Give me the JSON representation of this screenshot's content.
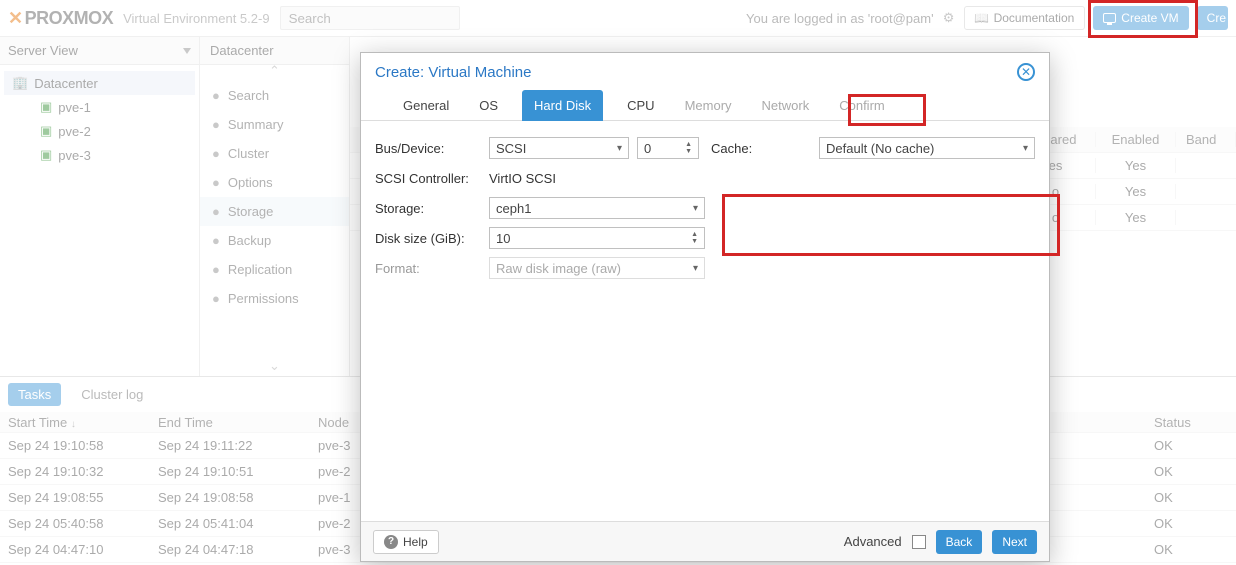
{
  "header": {
    "brand": "PROXMOX",
    "subtitle": "Virtual Environment 5.2-9",
    "search_placeholder": "Search",
    "login_msg": "You are logged in as 'root@pam'",
    "doc_label": "Documentation",
    "create_vm_label": "Create VM",
    "create_ct_label": "Cre"
  },
  "sidebar": {
    "mode": "Server View",
    "root": "Datacenter",
    "nodes": [
      "pve-1",
      "pve-2",
      "pve-3"
    ]
  },
  "mid": {
    "title": "Datacenter",
    "items": [
      {
        "label": "Search",
        "icon": "search-icon"
      },
      {
        "label": "Summary",
        "icon": "summary-icon"
      },
      {
        "label": "Cluster",
        "icon": "cluster-icon"
      },
      {
        "label": "Options",
        "icon": "options-icon"
      },
      {
        "label": "Storage",
        "icon": "storage-icon",
        "selected": true
      },
      {
        "label": "Backup",
        "icon": "backup-icon"
      },
      {
        "label": "Replication",
        "icon": "replication-icon"
      },
      {
        "label": "Permissions",
        "icon": "permissions-icon"
      }
    ]
  },
  "storage_table": {
    "cols": {
      "shared": "Shared",
      "enabled": "Enabled",
      "band": "Band"
    },
    "rows": [
      {
        "shared": "es",
        "enabled": "Yes"
      },
      {
        "shared": "o",
        "enabled": "Yes"
      },
      {
        "shared": "o",
        "enabled": "Yes"
      }
    ]
  },
  "tasks": {
    "tab_active": "Tasks",
    "tab_other": "Cluster log",
    "cols": {
      "start": "Start Time",
      "end": "End Time",
      "node": "Node",
      "status": "Status"
    },
    "rows": [
      {
        "start": "Sep 24 19:10:58",
        "end": "Sep 24 19:11:22",
        "node": "pve-3",
        "status": "OK"
      },
      {
        "start": "Sep 24 19:10:32",
        "end": "Sep 24 19:10:51",
        "node": "pve-2",
        "status": "OK"
      },
      {
        "start": "Sep 24 19:08:55",
        "end": "Sep 24 19:08:58",
        "node": "pve-1",
        "status": "OK"
      },
      {
        "start": "Sep 24 05:40:58",
        "end": "Sep 24 05:41:04",
        "node": "pve-2",
        "status": "OK"
      },
      {
        "start": "Sep 24 04:47:10",
        "end": "Sep 24 04:47:18",
        "node": "pve-3",
        "status": "OK"
      }
    ]
  },
  "modal": {
    "title": "Create: Virtual Machine",
    "tabs": [
      "General",
      "OS",
      "Hard Disk",
      "CPU",
      "Memory",
      "Network",
      "Confirm"
    ],
    "active_tab": "Hard Disk",
    "disabled_tabs": [
      "Memory",
      "Network",
      "Confirm"
    ],
    "form": {
      "bus_label": "Bus/Device:",
      "bus_value": "SCSI",
      "bus_index": "0",
      "cache_label": "Cache:",
      "cache_value": "Default (No cache)",
      "ctrl_label": "SCSI Controller:",
      "ctrl_value": "VirtIO SCSI",
      "storage_label": "Storage:",
      "storage_value": "ceph1",
      "size_label": "Disk size (GiB):",
      "size_value": "10",
      "format_label": "Format:",
      "format_value": "Raw disk image (raw)"
    },
    "footer": {
      "help": "Help",
      "advanced": "Advanced",
      "back": "Back",
      "next": "Next"
    }
  }
}
